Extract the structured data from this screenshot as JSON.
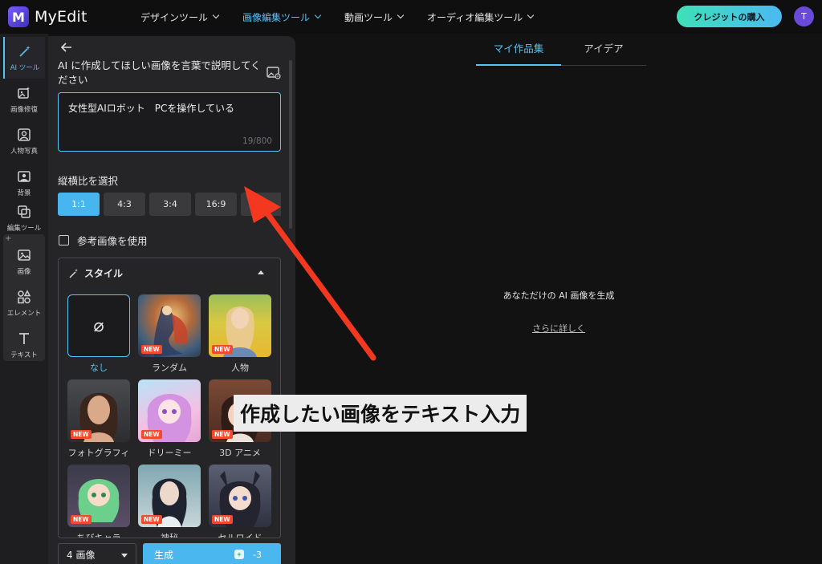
{
  "app": {
    "name": "MyEdit",
    "logo_letter": "M"
  },
  "nav": {
    "items": [
      {
        "label": "デザインツール",
        "active": false
      },
      {
        "label": "画像編集ツール",
        "active": true
      },
      {
        "label": "動画ツール",
        "active": false
      },
      {
        "label": "オーディオ編集ツール",
        "active": false
      }
    ],
    "credit_button": "クレジットの購入",
    "avatar_initial": "T"
  },
  "rail": {
    "items": [
      {
        "label": "AI ツール",
        "icon": "magic-wand-icon",
        "active": true
      },
      {
        "label": "画像修復",
        "icon": "image-repair-icon"
      },
      {
        "label": "人物写真",
        "icon": "portrait-icon"
      },
      {
        "label": "背景",
        "icon": "background-icon"
      },
      {
        "label": "編集ツール",
        "icon": "edit-tools-icon"
      },
      {
        "label": "画像",
        "icon": "image-icon"
      },
      {
        "label": "エレメント",
        "icon": "elements-icon"
      },
      {
        "label": "テキスト",
        "icon": "text-icon"
      }
    ],
    "plus": "+"
  },
  "panel": {
    "prompt_label": "AI に作成してほしい画像を言葉で説明してください",
    "prompt_value": "女性型AIロボット　PCを操作している",
    "prompt_count": "19/800",
    "ratio_label": "縦横比を選択",
    "ratios": [
      "1:1",
      "4:3",
      "3:4",
      "16:9",
      ""
    ],
    "ratio_selected": "1:1",
    "reference_label": "参考画像を使用",
    "style_heading": "スタイル",
    "styles": [
      {
        "label": "なし",
        "new": false,
        "selected": true,
        "glyph": "⌀"
      },
      {
        "label": "ランダム",
        "new": true,
        "badge": "NEW"
      },
      {
        "label": "人物",
        "new": true,
        "badge": "NEW"
      },
      {
        "label": "フォトグラフィ",
        "new": true,
        "badge": "NEW"
      },
      {
        "label": "ドリーミー",
        "new": true,
        "badge": "NEW"
      },
      {
        "label": "3D アニメ",
        "new": true,
        "badge": "NEW"
      },
      {
        "label": "ちびキャラ",
        "new": true,
        "badge": "NEW"
      },
      {
        "label": "神秘",
        "new": true,
        "badge": "NEW"
      },
      {
        "label": "セルロイド",
        "new": true,
        "badge": "NEW"
      }
    ],
    "count_select": "4 画像",
    "generate_label": "生成",
    "generate_cost": "-3"
  },
  "main": {
    "tabs": [
      "マイ作品集",
      "アイデア"
    ],
    "active_tab": "マイ作品集",
    "empty_text": "あなただけの AI 画像を生成",
    "more_link": "さらに詳しく"
  },
  "annotation": {
    "callout": "作成したい画像をテキスト入力",
    "arrow_color": "#f4381f"
  }
}
